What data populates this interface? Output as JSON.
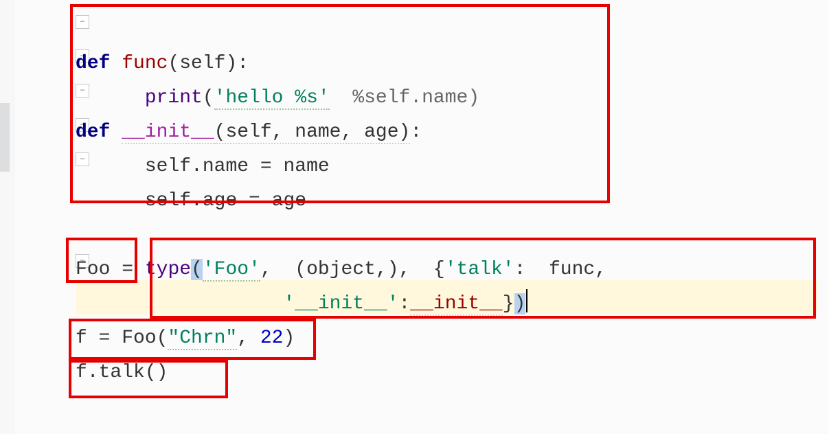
{
  "lines": {
    "l1_def": "def",
    "l1_name": "func",
    "l1_sig": "(self):",
    "l2_print": "print",
    "l2_str": "'hello %s'",
    "l2_rest": "  %self.name)",
    "l3_def": "def",
    "l3_dunder": "__init__",
    "l3_sig": "(self, name, age)",
    "l3_colon": ":",
    "l4": "self.name = name",
    "l5": "self.age = age",
    "l7_foo": "Foo",
    "l7_eq": " = ",
    "l7_type": "type",
    "l7_open": "(",
    "l7_str": "'Foo'",
    "l7_mid": ",  (object,),  {",
    "l7_key": "'talk'",
    "l7_after": ":  func,",
    "l8_pre": "                  ",
    "l8_k": "'__init__'",
    "l8_mid": ":",
    "l8_v": "__init__",
    "l8_close": "}",
    "l8_paren": ")",
    "l9_a": "f = Foo(",
    "l9_str": "\"Chrn\"",
    "l9_c": ", ",
    "l9_num": "22",
    "l9_d": ")",
    "l10": "f.talk()"
  }
}
